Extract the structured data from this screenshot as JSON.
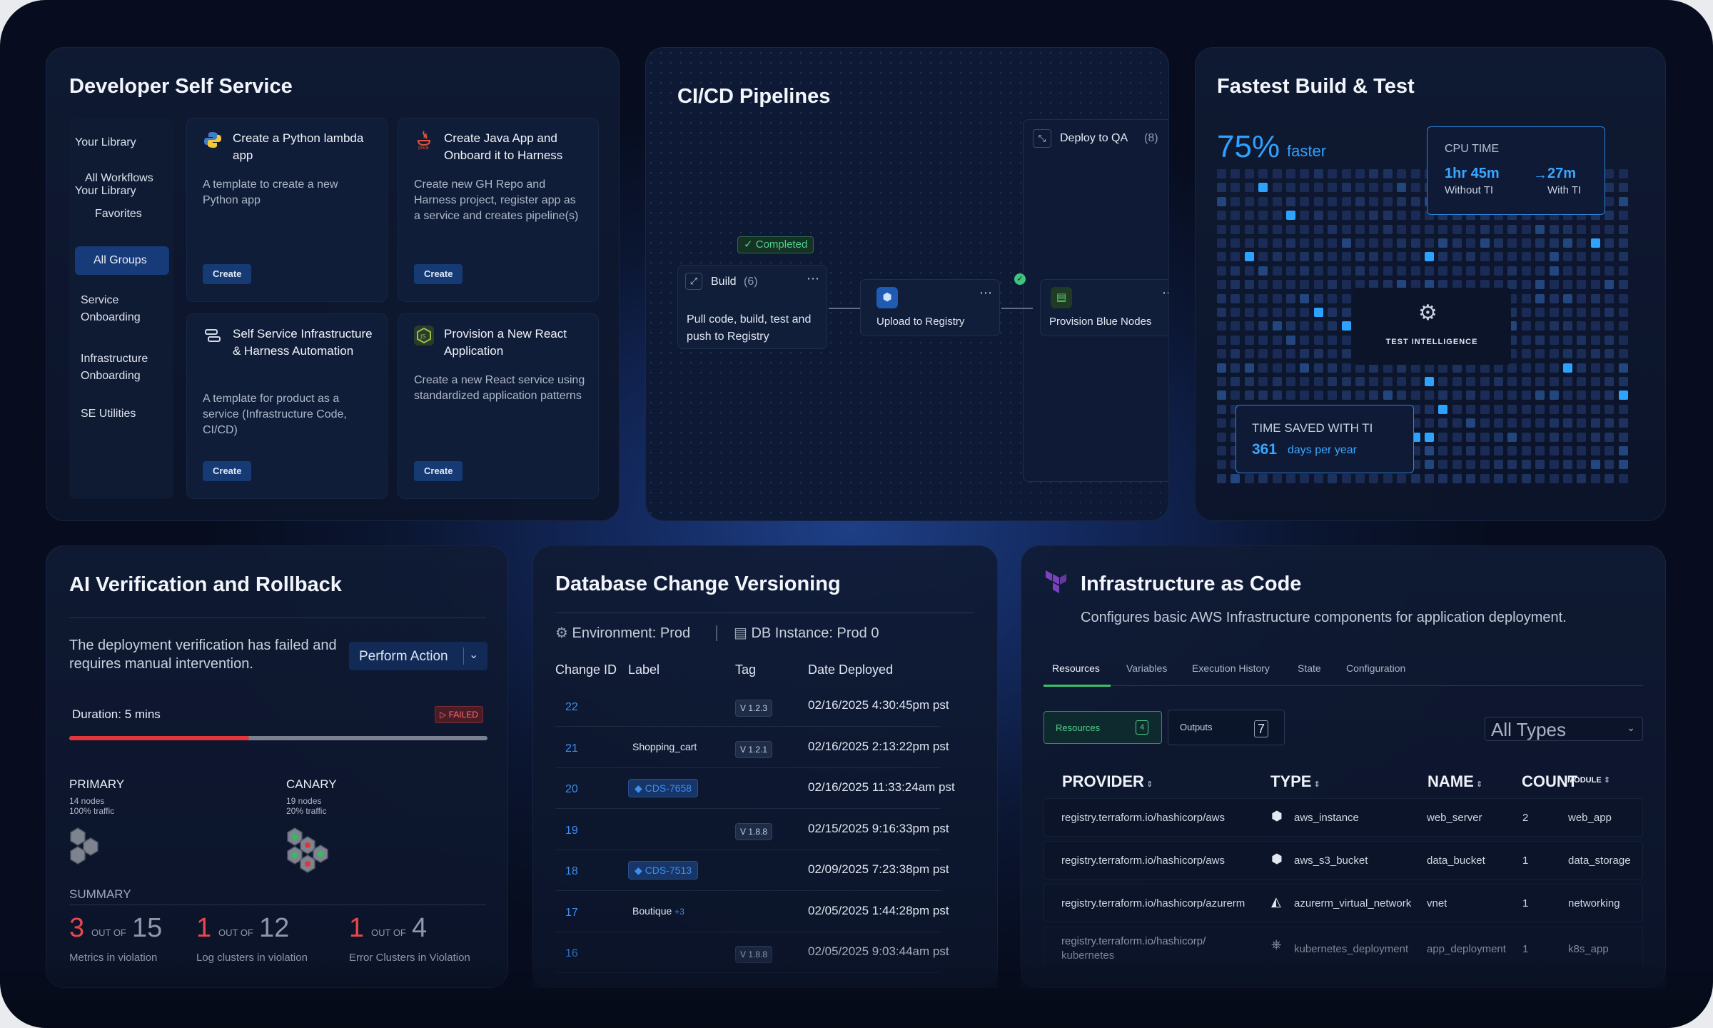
{
  "dss": {
    "title": "Developer Self Service",
    "sidebar": [
      "Your Library",
      "All Workflows",
      "Favorites",
      "All Groups",
      "Service Onboarding",
      "Infrastructure Onboarding",
      "SE Utilities"
    ],
    "cards": [
      {
        "title": "Create a Python lambda app",
        "desc": "A template to create a new Python app",
        "button": "Create",
        "icon": "python-icon"
      },
      {
        "title": "Create Java App and Onboard it to Harness",
        "desc": "Create new GH Repo and Harness project, register app as a service and creates pipeline(s)",
        "button": "Create",
        "icon": "java-icon"
      },
      {
        "title": "Self Service Infrastructure & Harness Automation",
        "desc": "A template for product as a service (Infrastructure Code, CI/CD)",
        "button": "Create",
        "icon": "infra-icon"
      },
      {
        "title": "Provision a New React Application",
        "desc": "Create a new React service using standardized application patterns",
        "button": "Create",
        "icon": "nodejs-icon"
      }
    ]
  },
  "cicd": {
    "title": "CI/CD Pipelines",
    "completed": "Completed",
    "build": {
      "label": "Build",
      "count": "(6)",
      "desc": "Pull code, build, test and push to Registry"
    },
    "upload": {
      "label": "Upload to Registry"
    },
    "deploy": {
      "label": "Deploy to QA",
      "count": "(8)"
    },
    "provision": {
      "label": "Provision Blue Nodes"
    }
  },
  "fbt": {
    "title": "Fastest Build & Test",
    "pct": "75%",
    "faster": "faster",
    "cpu": {
      "label": "CPU TIME",
      "without_val": "1hr 45m",
      "without_lbl": "Without TI",
      "with_val": "27m",
      "with_lbl": "With TI",
      "arrow": "→"
    },
    "ti_label": "TEST INTELLIGENCE",
    "saved": {
      "label": "TIME SAVED WITH TI",
      "value": "361",
      "unit": "days per year"
    }
  },
  "ai": {
    "title": "AI Verification and Rollback",
    "message": "The deployment verification has failed and requires manual intervention.",
    "action": "Perform Action",
    "duration": "Duration: 5 mins",
    "status": "FAILED",
    "progress": 0.43,
    "primary": {
      "label": "PRIMARY",
      "nodes": "14 nodes",
      "traffic": "100% traffic"
    },
    "canary": {
      "label": "CANARY",
      "nodes": "19 nodes",
      "traffic": "20% traffic"
    },
    "summary_label": "SUMMARY",
    "summary": [
      {
        "n": "3",
        "of": "OUT OF",
        "total": "15",
        "label": "Metrics in violation"
      },
      {
        "n": "1",
        "of": "OUT OF",
        "total": "12",
        "label": "Log clusters in violation"
      },
      {
        "n": "1",
        "of": "OUT OF",
        "total": "4",
        "label": "Error Clusters in Violation"
      }
    ]
  },
  "db": {
    "title": "Database Change Versioning",
    "env": "Environment: Prod",
    "instance": "DB Instance: Prod 0",
    "headers": [
      "Change ID",
      "Label",
      "Tag",
      "Date Deployed"
    ],
    "rows": [
      {
        "id": "22",
        "label": "",
        "tag": "V 1.2.3",
        "date": "02/16/2025 4:30:45pm pst"
      },
      {
        "id": "21",
        "label": "Shopping_cart",
        "tag": "V 1.2.1",
        "date": "02/16/2025 2:13:22pm pst"
      },
      {
        "id": "20",
        "label": "CDS-7658",
        "tag": "",
        "date": "02/16/2025 11:33:24am pst"
      },
      {
        "id": "19",
        "label": "",
        "tag": "V 1.8.8",
        "date": "02/15/2025 9:16:33pm pst"
      },
      {
        "id": "18",
        "label": "CDS-7513",
        "tag": "",
        "date": "02/09/2025 7:23:38pm pst"
      },
      {
        "id": "17",
        "label": "Boutique",
        "extra": "+3",
        "tag": "",
        "date": "02/05/2025 1:44:28pm pst"
      },
      {
        "id": "16",
        "label": "",
        "tag": "V 1.8.8",
        "date": "02/05/2025 9:03:44am pst"
      }
    ]
  },
  "iac": {
    "title": "Infrastructure as Code",
    "subtitle": "Configures basic AWS Infrastructure components for application deployment.",
    "tabs": [
      "Resources",
      "Variables",
      "Execution History",
      "State",
      "Configuration"
    ],
    "resources_btn": "Resources",
    "resources_count": "4",
    "outputs_btn": "Outputs",
    "outputs_count": "7",
    "filter": "All Types",
    "headers": [
      "PROVIDER",
      "TYPE",
      "NAME",
      "COUNT",
      "MODULE"
    ],
    "rows": [
      {
        "provider": "registry.terraform.io/hashicorp/aws",
        "type": "aws_instance",
        "name": "web_server",
        "count": "2",
        "module": "web_app"
      },
      {
        "provider": "registry.terraform.io/hashicorp/aws",
        "type": "aws_s3_bucket",
        "name": "data_bucket",
        "count": "1",
        "module": "data_storage"
      },
      {
        "provider": "registry.terraform.io/hashicorp/azurerm",
        "type": "azurerm_virtual_network",
        "name": "vnet",
        "count": "1",
        "module": "networking"
      },
      {
        "provider": "registry.terraform.io/hashicorp/ kubernetes",
        "type": "kubernetes_deployment",
        "name": "app_deployment",
        "count": "1",
        "module": "k8s_app"
      }
    ]
  }
}
